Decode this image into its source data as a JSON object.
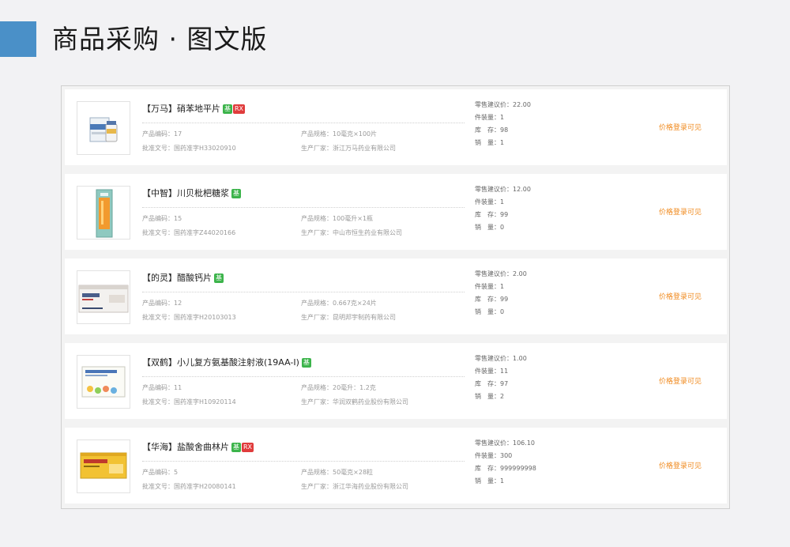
{
  "page": {
    "title": "商品采购 · 图文版",
    "accent_color": "#4a90c8"
  },
  "labels": {
    "code": "产品编码：",
    "approval": "批准文号：",
    "spec": "产品规格：",
    "maker": "生产厂家：",
    "retail": "零售建议价：",
    "pack": "件装量：",
    "stock": "库　存：",
    "sales": "销　量：",
    "login_price": "价格登录可见",
    "tag_ji": "基",
    "tag_rx": "RX"
  },
  "products": [
    {
      "brand": "【万马】",
      "name": "硝苯地平片",
      "tags": [
        "ji",
        "rx"
      ],
      "code": "17",
      "approval": "国药准字H33020910",
      "spec": "10毫克×100片",
      "maker": "浙江万马药业有限公司",
      "retail": "22.00",
      "pack": "1",
      "stock": "98",
      "sales": "1",
      "image_icon": "pill-bottle-box-icon"
    },
    {
      "brand": "【中智】",
      "name": "川贝枇杷糖浆",
      "tags": [
        "ji"
      ],
      "code": "15",
      "approval": "国药准字Z44020166",
      "spec": "100毫升×1瓶",
      "maker": "中山市恒生药业有限公司",
      "retail": "12.00",
      "pack": "1",
      "stock": "99",
      "sales": "0",
      "image_icon": "syrup-box-icon"
    },
    {
      "brand": "【的灵】",
      "name": "醋酸钙片",
      "tags": [
        "ji"
      ],
      "code": "12",
      "approval": "国药准字H20103013",
      "spec": "0.667克×24片",
      "maker": "昆明邦宇制药有限公司",
      "retail": "2.00",
      "pack": "1",
      "stock": "99",
      "sales": "0",
      "image_icon": "tablet-box-icon"
    },
    {
      "brand": "【双鹤】",
      "name": "小儿复方氨基酸注射液(19AA-Ⅰ)",
      "tags": [
        "ji"
      ],
      "code": "11",
      "approval": "国药准字H10920114",
      "spec": "20毫升：1.2克",
      "maker": "华润双鹤药业股份有限公司",
      "retail": "1.00",
      "pack": "11",
      "stock": "97",
      "sales": "2",
      "image_icon": "injection-box-icon"
    },
    {
      "brand": "【华海】",
      "name": "盐酸舍曲林片",
      "tags": [
        "ji",
        "rx"
      ],
      "code": "5",
      "approval": "国药准字H20080141",
      "spec": "50毫克×28粒",
      "maker": "浙江华海药业股份有限公司",
      "retail": "106.10",
      "pack": "300",
      "stock": "999999998",
      "sales": "1",
      "image_icon": "yellow-medicine-box-icon"
    }
  ]
}
